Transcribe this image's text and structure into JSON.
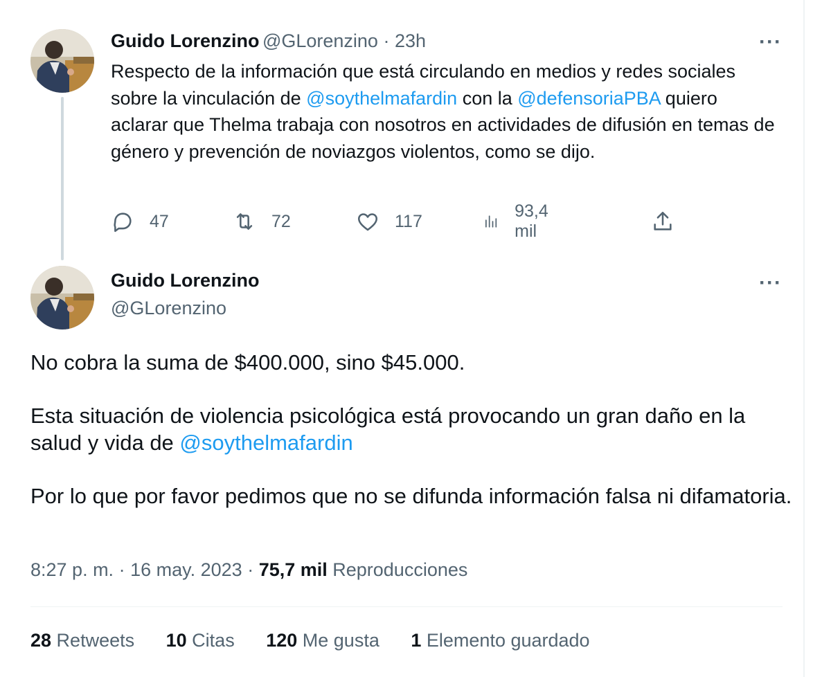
{
  "tweet1": {
    "author_name": "Guido Lorenzino",
    "handle": "@GLorenzino",
    "separator": " · ",
    "time": "23h",
    "text_parts": [
      "Respecto de la información que está circulando en medios y redes sociales sobre la vinculación de ",
      "@soythelmafardin",
      " con la ",
      "@defensoriaPBA",
      " quiero aclarar que Thelma trabaja con nosotros en actividades de difusión en temas de género y prevención de noviazgos violentos, como se dijo."
    ],
    "more_label": "···",
    "actions": {
      "replies": "47",
      "retweets": "72",
      "likes": "117",
      "views": "93,4 mil"
    }
  },
  "tweet2": {
    "author_name": "Guido Lorenzino",
    "handle": "@GLorenzino",
    "more_label": "···",
    "paragraph1": "No cobra la suma de $400.000, sino $45.000.",
    "paragraph2_text": "Esta situación de violencia psicológica está provocando un gran daño en la salud y vida de ",
    "paragraph2_mention": "@soythelmafardin",
    "paragraph3": "Por lo que por favor pedimos que no se difunda información falsa ni difamatoria.",
    "meta": {
      "time": "8:27 p. m.",
      "sep1": " · ",
      "date": "16 may. 2023",
      "sep2": " · ",
      "views": "75,7 mil",
      "views_label": " Reproducciones"
    },
    "stats": {
      "retweets_count": "28",
      "retweets_label": " Retweets",
      "quotes_count": "10",
      "quotes_label": " Citas",
      "likes_count": "120",
      "likes_label": " Me gusta",
      "bookmarks_count": "1",
      "bookmarks_label": " Elemento guardado"
    }
  },
  "colors": {
    "link": "#1d9bf0",
    "secondary_text": "#536471",
    "primary_text": "#0f1419",
    "thread_line": "#cfd9de"
  },
  "icons": {
    "reply": "reply-icon",
    "retweet": "retweet-icon",
    "like": "heart-icon",
    "views": "views-bar-icon",
    "share": "share-icon",
    "more": "more-dots-icon"
  }
}
